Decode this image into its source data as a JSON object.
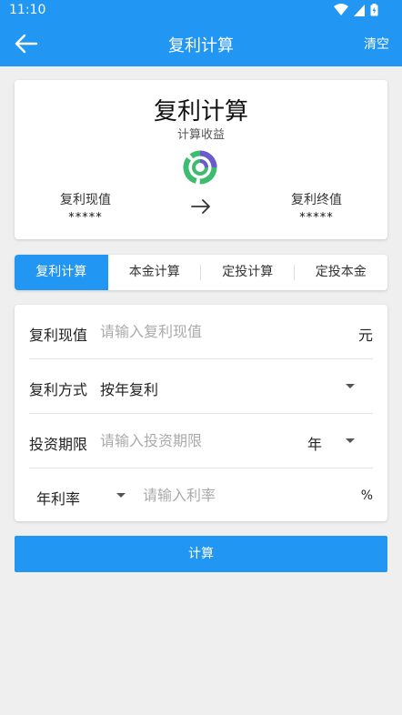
{
  "status": {
    "time": "11:10"
  },
  "appbar": {
    "title": "复利计算",
    "clear_label": "清空"
  },
  "summary": {
    "title": "复利计算",
    "subtitle": "计算收益",
    "present_label": "复利现值",
    "present_value": "*****",
    "future_label": "复利终值",
    "future_value": "*****"
  },
  "tabs": [
    {
      "label": "复利计算"
    },
    {
      "label": "本金计算"
    },
    {
      "label": "定投计算"
    },
    {
      "label": "定投本金"
    }
  ],
  "form": {
    "present": {
      "label": "复利现值",
      "placeholder": "请输入复利现值",
      "unit": "元"
    },
    "method": {
      "label": "复利方式",
      "value": "按年复利"
    },
    "period": {
      "label": "投资期限",
      "placeholder": "请输入投资期限",
      "unit": "年"
    },
    "rate": {
      "type": "年利率",
      "placeholder": "请输入利率",
      "unit": "%"
    }
  },
  "actions": {
    "calculate_label": "计算"
  },
  "colors": {
    "primary": "#2196f3",
    "background": "#efefef"
  }
}
